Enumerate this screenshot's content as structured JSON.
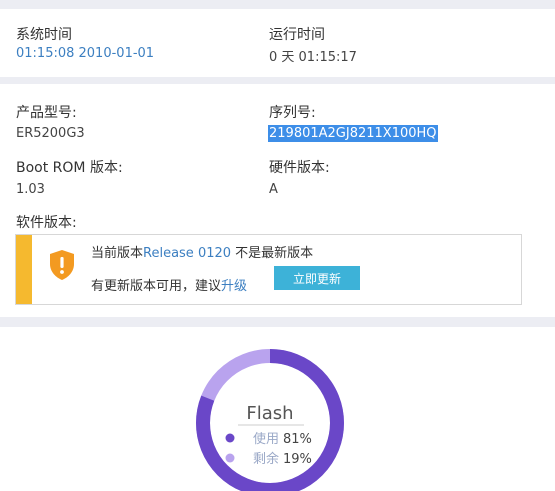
{
  "time": {
    "system_time_label": "系统时间",
    "system_time_value": "01:15:08  2010-01-01",
    "uptime_label": "运行时间",
    "uptime_value": "0 天   01:15:17"
  },
  "info": {
    "model_label": "产品型号:",
    "model_value": "ER5200G3",
    "serial_label": "序列号:",
    "serial_value": "219801A2GJ8211X100HQ",
    "bootrom_label": "Boot ROM 版本:",
    "bootrom_value": "1.03",
    "hw_label": "硬件版本:",
    "hw_value": "A",
    "sw_label": "软件版本:"
  },
  "notice": {
    "current_prefix": "当前版本",
    "release_link": "Release 0120",
    "current_suffix": " 不是最新版本",
    "update_available": "有更新版本可用，建议",
    "upgrade_link": "升级",
    "update_button": "立即更新",
    "accent_color": "#f5b92f",
    "icon": "shield-warning-icon"
  },
  "flash": {
    "title": "Flash",
    "used_label": "使用",
    "used_value": "81%",
    "free_label": "剩余",
    "free_value": "19%",
    "used_fraction": 0.81,
    "free_fraction": 0.19,
    "used_color": "#6a47c8",
    "free_color": "#b9a3ee"
  }
}
